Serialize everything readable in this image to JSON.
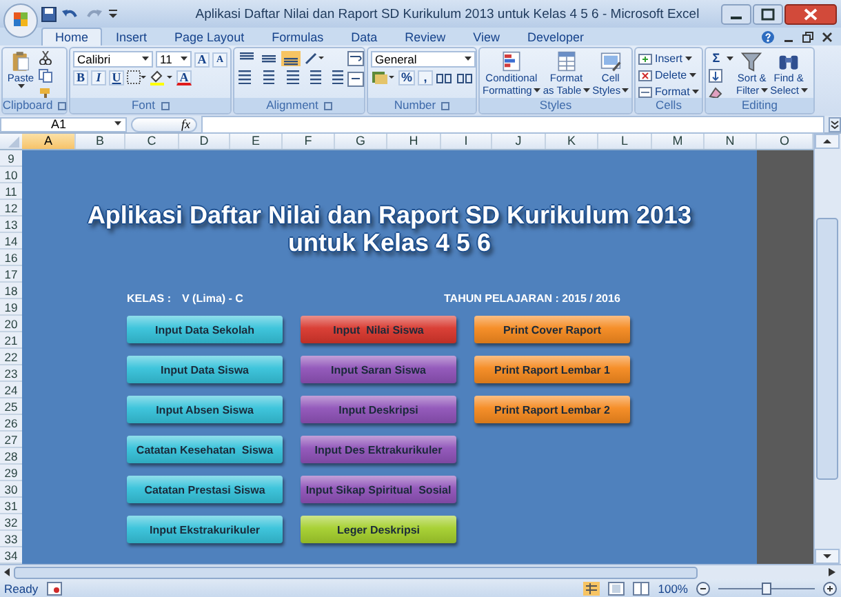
{
  "window": {
    "title": "Aplikasi Daftar Nilai dan Raport SD Kurikulum 2013 untuk Kelas 4 5 6 - Microsoft Excel"
  },
  "tabs": [
    {
      "label": "Home",
      "selected": true
    },
    {
      "label": "Insert",
      "selected": false
    },
    {
      "label": "Page Layout",
      "selected": false
    },
    {
      "label": "Formulas",
      "selected": false
    },
    {
      "label": "Data",
      "selected": false
    },
    {
      "label": "Review",
      "selected": false
    },
    {
      "label": "View",
      "selected": false
    },
    {
      "label": "Developer",
      "selected": false
    }
  ],
  "ribbon": {
    "groups": [
      {
        "kind": "clipboard",
        "label": "Clipboard",
        "paste": "Paste"
      },
      {
        "kind": "font",
        "label": "Font",
        "font_name": "Calibri",
        "font_size": "11",
        "grow": "A",
        "shrink": "A",
        "bold": "B",
        "italic": "I",
        "underline": "U",
        "font_color": "A"
      },
      {
        "kind": "alignment",
        "label": "Alignment"
      },
      {
        "kind": "number",
        "label": "Number",
        "format": "General",
        "percent": "%",
        "comma": ","
      },
      {
        "kind": "styles",
        "label": "Styles",
        "buttons": [
          {
            "lines": [
              "Conditional",
              "Formatting"
            ]
          },
          {
            "lines": [
              "Format",
              "as Table"
            ]
          },
          {
            "lines": [
              "Cell",
              "Styles"
            ]
          }
        ]
      },
      {
        "kind": "cells",
        "label": "Cells",
        "buttons": [
          "Insert",
          "Delete",
          "Format"
        ]
      },
      {
        "kind": "editing",
        "label": "Editing",
        "sigma": "Σ",
        "buttons": [
          {
            "lines": [
              "Sort &",
              "Filter"
            ]
          },
          {
            "lines": [
              "Find &",
              "Select"
            ]
          }
        ]
      }
    ]
  },
  "formula_bar": {
    "name_box": "A1",
    "fx": "fx"
  },
  "sheet": {
    "columns": [
      {
        "label": "A",
        "selected": true
      },
      {
        "label": "B",
        "selected": false
      },
      {
        "label": "C",
        "selected": false
      },
      {
        "label": "D",
        "selected": false
      },
      {
        "label": "E",
        "selected": false
      },
      {
        "label": "F",
        "selected": false
      },
      {
        "label": "G",
        "selected": false
      },
      {
        "label": "H",
        "selected": false
      },
      {
        "label": "I",
        "selected": false
      },
      {
        "label": "J",
        "selected": false
      },
      {
        "label": "K",
        "selected": false
      },
      {
        "label": "L",
        "selected": false
      },
      {
        "label": "M",
        "selected": false
      },
      {
        "label": "N",
        "selected": false
      },
      {
        "label": "O",
        "selected": false
      }
    ],
    "rows": [
      "9",
      "10",
      "11",
      "12",
      "13",
      "14",
      "16",
      "17",
      "18",
      "19",
      "20",
      "21",
      "22",
      "23",
      "24",
      "25",
      "26",
      "27",
      "28",
      "29",
      "30",
      "31",
      "32",
      "33",
      "34"
    ],
    "title_lines": [
      "Aplikasi Daftar Nilai dan Raport SD Kurikulum 2013",
      "untuk Kelas 4 5 6"
    ],
    "kelas_label": "KELAS :",
    "kelas_value": "V (Lima) - C",
    "tahun": "TAHUN PELAJARAN : 2015 / 2016",
    "button_columns": [
      [
        {
          "label": "Input Data Sekolah",
          "color": "#35c2da"
        },
        {
          "label": "Input Data Siswa",
          "color": "#35c2da"
        },
        {
          "label": "Input Absen Siswa",
          "color": "#35c2da"
        },
        {
          "label": "Catatan Kesehatan  Siswa",
          "color": "#35c2da"
        },
        {
          "label": "Catatan Prestasi Siswa",
          "color": "#35c2da"
        },
        {
          "label": "Input Ekstrakurikuler",
          "color": "#35c2da"
        }
      ],
      [
        {
          "label": "Input  Nilai Siswa",
          "color": "#d8362c"
        },
        {
          "label": "Input Saran Siswa",
          "color": "#8f52b8"
        },
        {
          "label": "Input Deskripsi",
          "color": "#8f52b8"
        },
        {
          "label": "Input Des Ektrakurikuler",
          "color": "#8f52b8"
        },
        {
          "label": "Input Sikap Spiritual  Sosial",
          "color": "#8f52b8"
        },
        {
          "label": "Leger Deskripsi",
          "color": "#a4cf2c"
        }
      ],
      [
        {
          "label": "Print Cover Raport",
          "color": "#f5891e"
        },
        {
          "label": "Print Raport Lembar 1",
          "color": "#f5891e"
        },
        {
          "label": "Print Raport Lembar 2",
          "color": "#f5891e"
        }
      ]
    ]
  },
  "status_bar": {
    "text": "Ready",
    "zoom": "100%",
    "zoom_slider": {
      "level": 0.5
    }
  }
}
